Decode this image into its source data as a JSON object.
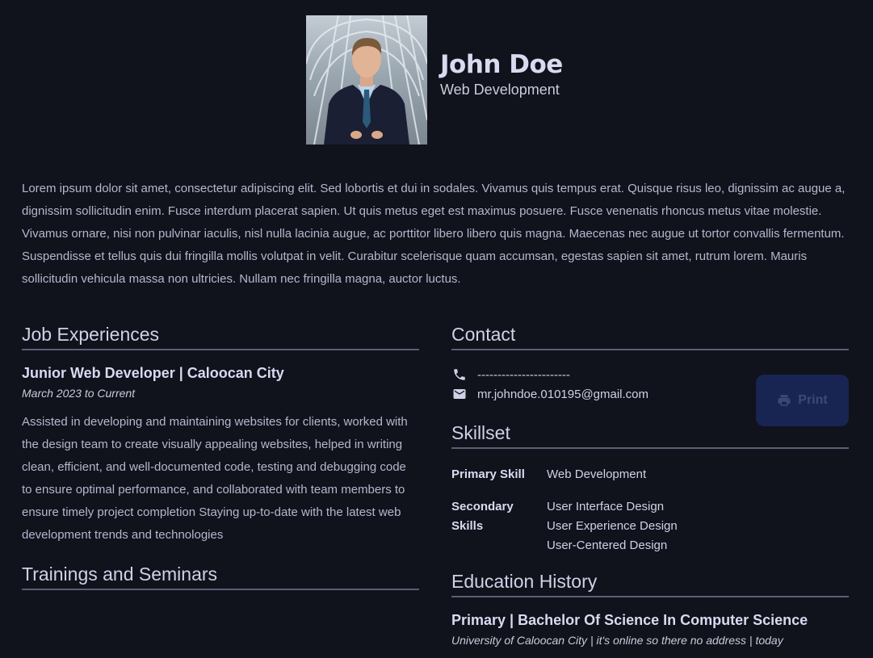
{
  "profile": {
    "name": "John Doe",
    "role": "Web Development"
  },
  "about": "Lorem ipsum dolor sit amet, consectetur adipiscing elit. Sed lobortis et dui in sodales. Vivamus quis tempus erat. Quisque risus leo, dignissim ac augue a, dignissim sollicitudin enim. Fusce interdum placerat sapien. Ut quis metus eget est maximus posuere. Fusce venenatis rhoncus metus vitae molestie. Vivamus ornare, nisi non pulvinar iaculis, nisl nulla lacinia augue, ac porttitor libero libero quis magna. Maecenas nec augue ut tortor convallis fermentum. Suspendisse et tellus quis dui fringilla mollis volutpat in velit. Curabitur scelerisque quam accumsan, egestas sapien sit amet, rutrum lorem. Mauris sollicitudin vehicula massa non ultricies. Nullam nec fringilla magna, auctor luctus.",
  "job": {
    "section_title": "Job Experiences",
    "title": "Junior Web Developer | Caloocan City",
    "date": "March 2023 to Current",
    "description": "Assisted in developing and maintaining websites for clients, worked with the design team to create visually appealing websites, helped in writing clean, efficient, and well-documented code, testing and debugging code to ensure optimal performance, and collaborated with team members to ensure timely project completion Staying up-to-date with the latest web development trends and technologies"
  },
  "trainings": {
    "section_title": "Trainings and Seminars"
  },
  "contact": {
    "section_title": "Contact",
    "phone": "-----------------------",
    "email": "mr.johndoe.010195@gmail.com",
    "phone_icon": "phone-icon",
    "email_icon": "mail-icon"
  },
  "skills": {
    "section_title": "Skillset",
    "primary_label": "Primary Skill",
    "primary": "Web Development",
    "secondary_label": "Secondary Skills",
    "secondary": [
      "User Interface Design",
      "User Experience Design",
      "User-Centered Design"
    ]
  },
  "education": {
    "section_title": "Education History",
    "degree": "Primary | Bachelor Of Science In Computer Science",
    "school": "University of Caloocan City | it's online so there no address | today"
  },
  "print_button": {
    "label": "Print",
    "icon": "printer-icon",
    "color": "#182552"
  },
  "colors": {
    "background": "#10121c",
    "text": "#c9ccdc",
    "divider": "#5a5f74"
  }
}
